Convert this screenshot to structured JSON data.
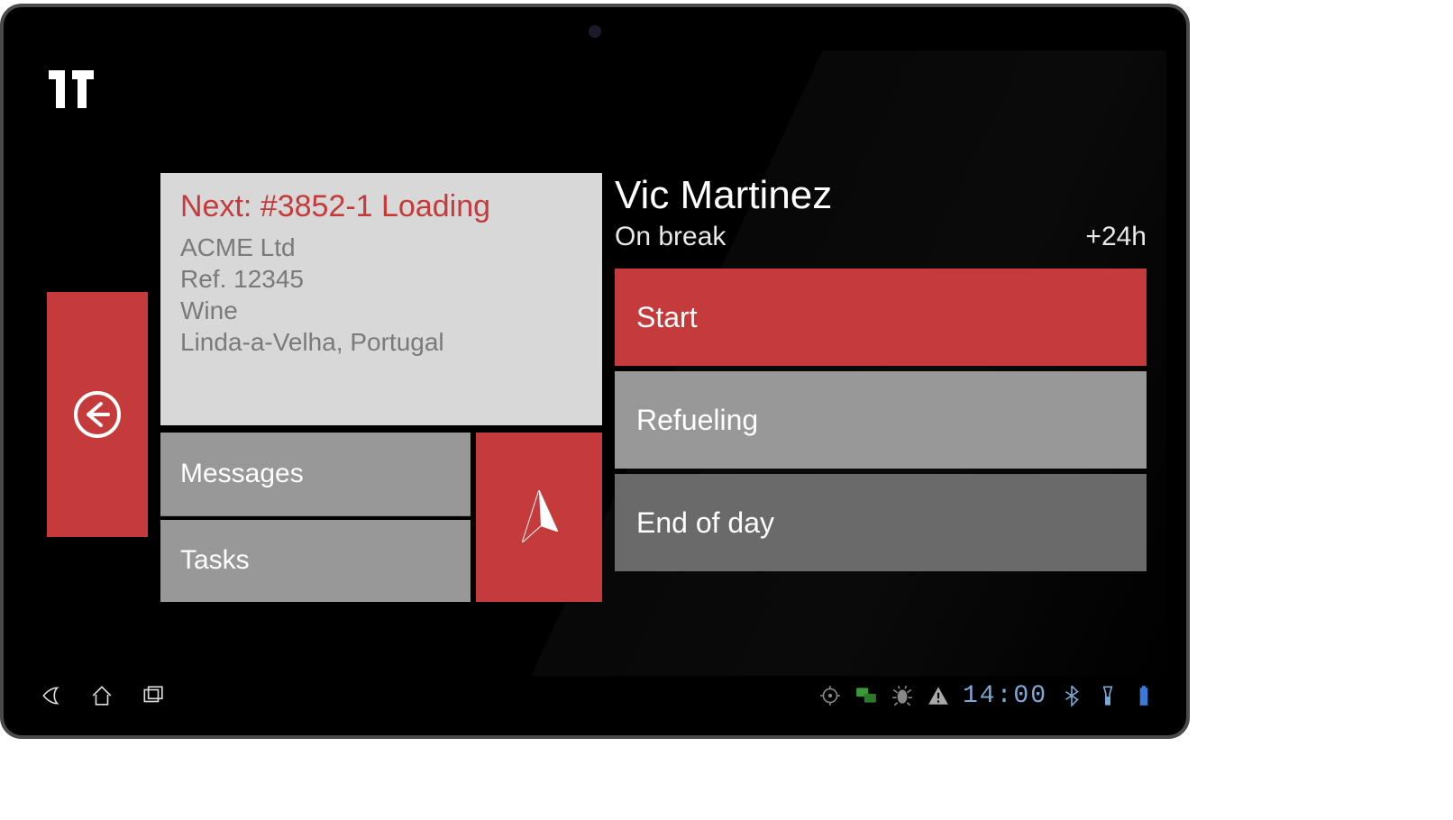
{
  "card": {
    "title": "Next: #3852-1 Loading",
    "company": "ACME Ltd",
    "reference": "Ref. 12345",
    "product": "Wine",
    "location": "Linda-a-Velha, Portugal",
    "messages_label": "Messages",
    "tasks_label": "Tasks"
  },
  "driver": {
    "name": "Vic Martinez",
    "status": "On break",
    "time_remaining": "+24h",
    "actions": {
      "start": "Start",
      "refueling": "Refueling",
      "end_of_day": "End of day"
    }
  },
  "navbar": {
    "clock": "14:00"
  },
  "icons": {
    "logo": "logo",
    "back": "back-arrow-circle",
    "cursor": "cursor-arrow",
    "nav_back": "back",
    "nav_home": "home",
    "nav_recent": "recent-apps",
    "target": "gps-target",
    "chat": "chat",
    "debug": "debug",
    "warning": "warning",
    "bluetooth": "bluetooth",
    "flashlight": "flashlight",
    "battery": "battery"
  }
}
